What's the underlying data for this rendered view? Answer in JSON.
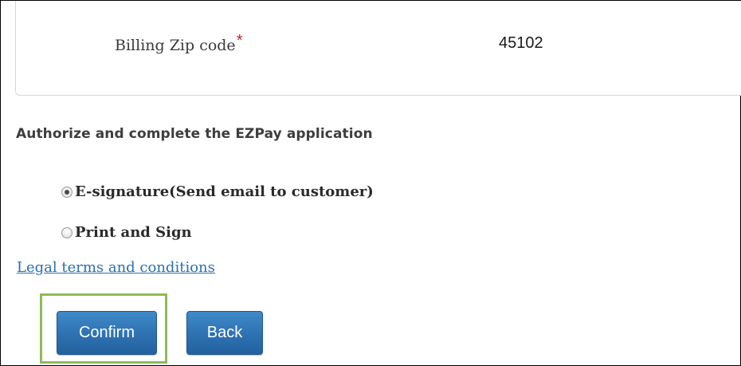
{
  "billing": {
    "zip_label": "Billing Zip code",
    "required_marker": "*",
    "zip_value": "45102"
  },
  "authorize": {
    "heading": "Authorize and complete the EZPay application",
    "options": [
      {
        "label": "E-signature(Send email to customer)",
        "selected": true
      },
      {
        "label": "Print and Sign",
        "selected": false
      }
    ]
  },
  "legal_link": "Legal terms and conditions",
  "buttons": {
    "confirm": "Confirm",
    "back": "Back"
  },
  "colors": {
    "button_blue": "#2f73b3",
    "highlight_green": "#8dbb57",
    "link_blue": "#2a6fb0",
    "required_red": "#cc1f1f"
  }
}
